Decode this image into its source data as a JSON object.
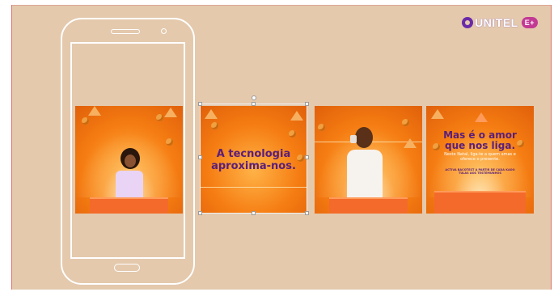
{
  "brand": {
    "logo_text": "UNITEL",
    "logo_badge": "E+",
    "accent": "#6a2aa8",
    "badge_color": "#c23a94"
  },
  "canvas": {
    "background": "#e4c9ad"
  },
  "phone": {
    "icon": "smartphone-outline-icon"
  },
  "tiles": [
    {
      "name": "girl-with-phone"
    },
    {
      "name": "headline",
      "headline_line1": "A tecnologia",
      "headline_line2": "aproxima-nos."
    },
    {
      "name": "man-with-tin-can-phone"
    },
    {
      "name": "gift-box",
      "headline_line1": "Mas é o amor",
      "headline_line2": "que nos liga.",
      "sub": "Neste Natal, liga-te a quem amas e oferece o presente.",
      "legal": "ACTIVA BACOTEST A PARTIR DE CADA KAOO TULAS AOS TESTEMUNHOS"
    }
  ]
}
